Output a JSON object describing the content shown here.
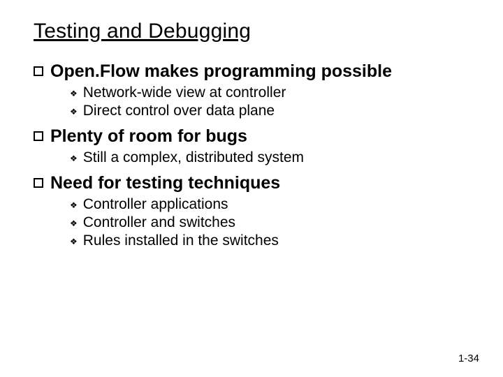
{
  "title": "Testing and Debugging",
  "points": [
    {
      "label": "Open.Flow makes programming possible",
      "subs": [
        "Network-wide view at controller",
        "Direct control over data plane"
      ]
    },
    {
      "label": "Plenty of room for bugs",
      "subs": [
        "Still a complex, distributed system"
      ]
    },
    {
      "label": "Need for testing techniques",
      "subs": [
        "Controller applications",
        "Controller and switches",
        "Rules installed in the switches"
      ]
    }
  ],
  "pagenum": "1-34"
}
